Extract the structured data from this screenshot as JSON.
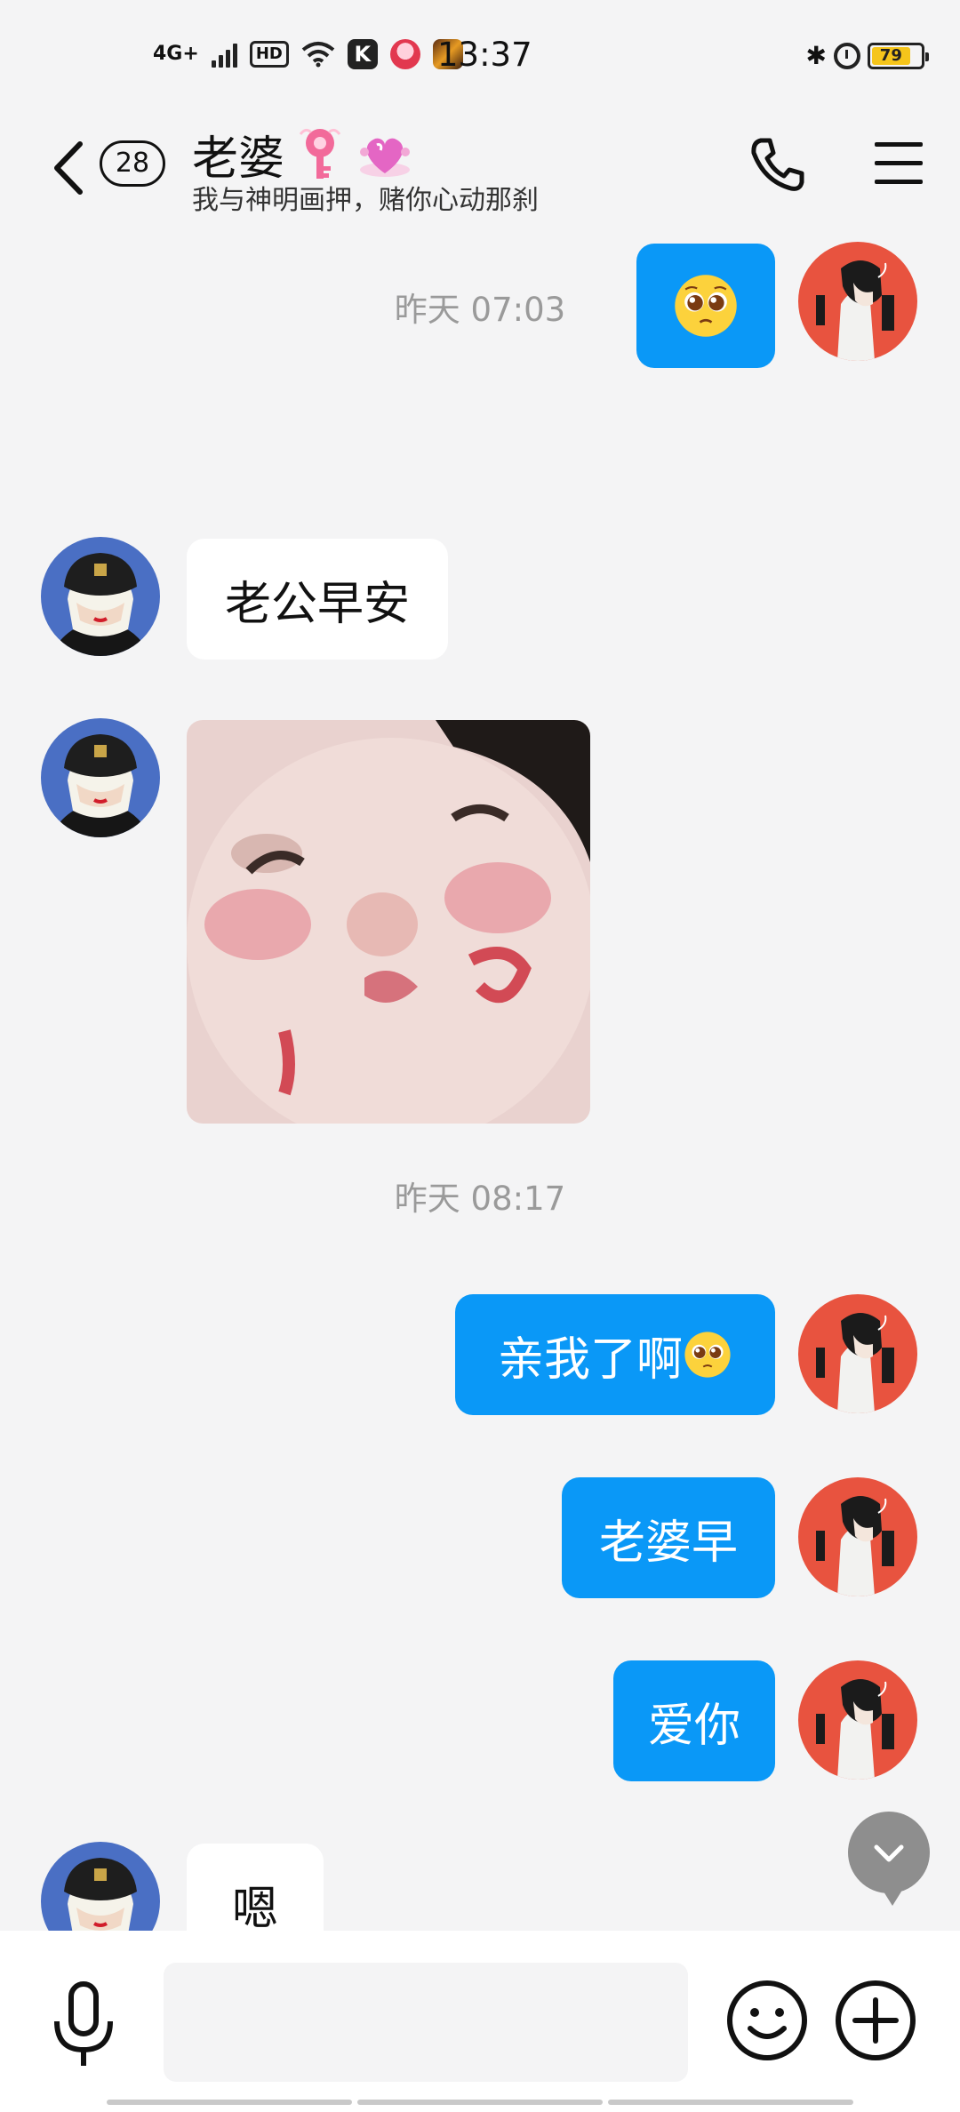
{
  "status_bar": {
    "network": "4G+",
    "hd": "HD",
    "k_app": "K",
    "time": "13:37",
    "battery": "79",
    "icons": [
      "signal-icon",
      "hd-icon",
      "wifi-icon",
      "k-app-icon",
      "app-icon",
      "game-icon",
      "bluetooth-icon",
      "alarm-icon",
      "battery-icon"
    ]
  },
  "header": {
    "back_icon": "chevron-left-icon",
    "unread_count": "28",
    "title": "老婆",
    "title_badges": [
      "key-badge-icon",
      "heart-badge-icon"
    ],
    "signature": "我与神明画押，赌你心动那刹",
    "call_icon": "phone-icon",
    "menu_icon": "menu-icon"
  },
  "messages": [
    {
      "side": "out",
      "type": "emoji",
      "emoji": "pleading-face-emoji"
    },
    {
      "type": "timestamp",
      "text": "昨天 07:03"
    },
    {
      "side": "in",
      "type": "text",
      "text": "老公早安"
    },
    {
      "side": "in",
      "type": "image",
      "image": "baby-photo"
    },
    {
      "type": "timestamp",
      "text": "昨天 08:17"
    },
    {
      "side": "out",
      "type": "text",
      "text": "亲我了啊",
      "emoji": "pleading-face-emoji"
    },
    {
      "side": "out",
      "type": "text",
      "text": "老婆早"
    },
    {
      "side": "out",
      "type": "text",
      "text": "爱你"
    },
    {
      "side": "in",
      "type": "text",
      "text": "嗯"
    }
  ],
  "input_bar": {
    "voice_icon": "microphone-icon",
    "input_value": "",
    "emoji_icon": "smile-icon",
    "more_icon": "plus-icon"
  },
  "colors": {
    "background": "#f4f4f5",
    "outgoing_bubble": "#0a98f7",
    "incoming_bubble": "#ffffff",
    "timestamp_text": "#9a9a9a",
    "battery": "#f5c51b"
  }
}
